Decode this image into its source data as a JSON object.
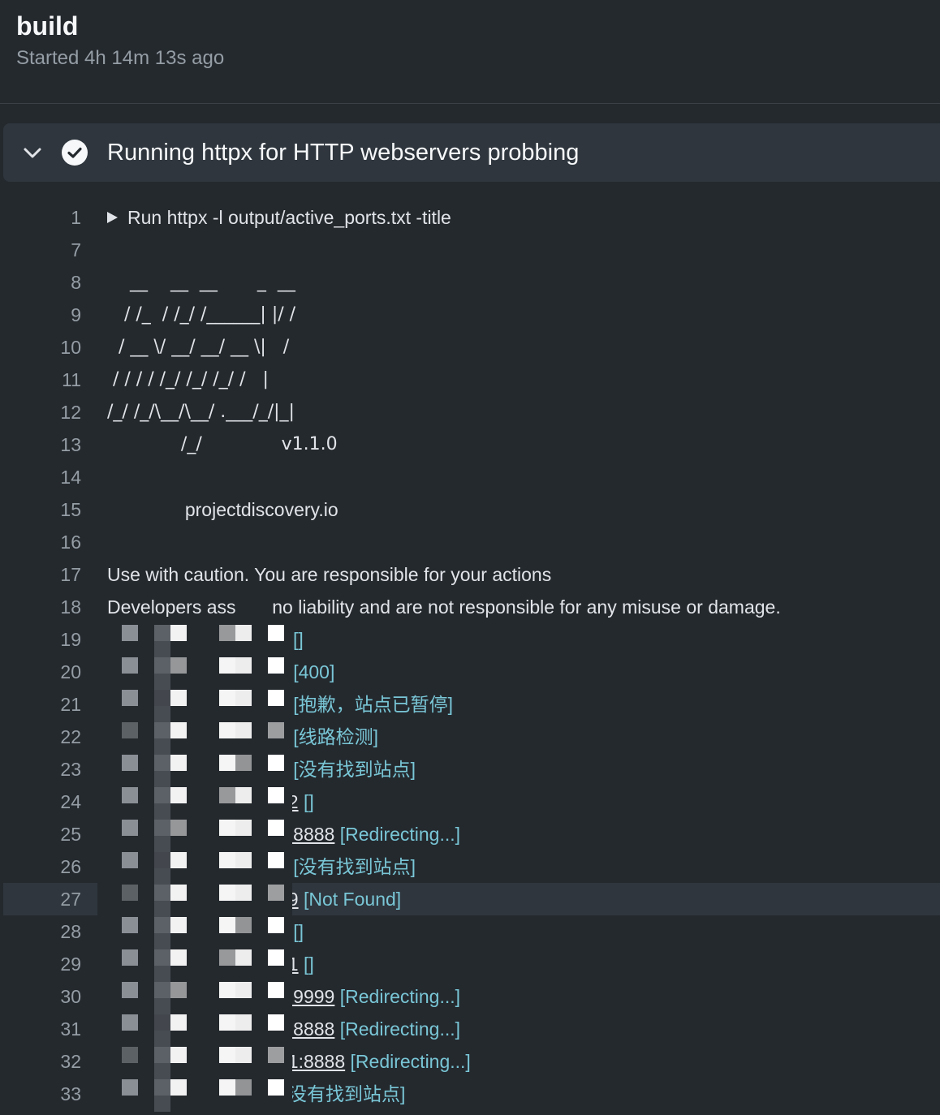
{
  "job": {
    "title": "build",
    "started": "Started 4h 14m 13s ago"
  },
  "step": {
    "title": "Running httpx for HTTP webservers probbing",
    "expand_icon": "chevron-down-icon",
    "status_icon": "check-circle-icon"
  },
  "colors": {
    "background": "#24292e",
    "step_header": "#2f363d",
    "tag_text": "#79c6d6",
    "line_number": "#959da5"
  },
  "log_lines": [
    {
      "num": "1",
      "kind": "cmd",
      "text": "Run httpx -l output/active_ports.txt -title"
    },
    {
      "num": "7",
      "kind": "blank",
      "text": ""
    },
    {
      "num": "8",
      "kind": "ascii",
      "text": "    __    __  __       _  __"
    },
    {
      "num": "9",
      "kind": "ascii",
      "text": "   / /_  / /_/ /______| |/ /"
    },
    {
      "num": "10",
      "kind": "ascii",
      "text": "  / __ \\/ __/ __/ __ \\|   /"
    },
    {
      "num": "11",
      "kind": "ascii",
      "text": " / / / / /_/ /_/ /_/ /   |"
    },
    {
      "num": "12",
      "kind": "ascii",
      "text": "/_/ /_/\\__/\\__/ .___/_/|_|"
    },
    {
      "num": "13",
      "kind": "ascii",
      "text": "             /_/              v1.1.0"
    },
    {
      "num": "14",
      "kind": "blank",
      "text": ""
    },
    {
      "num": "15",
      "kind": "plain",
      "text": "               projectdiscovery.io"
    },
    {
      "num": "16",
      "kind": "blank",
      "text": ""
    },
    {
      "num": "17",
      "kind": "plain",
      "text": "Use with caution. You are responsible for your actions"
    },
    {
      "num": "18",
      "kind": "plain",
      "text": "Developers ass       no liability and are not responsible for any misuse or damage."
    },
    {
      "num": "19",
      "kind": "result",
      "url_start": "h",
      "url_end": "3",
      "tag": "[]"
    },
    {
      "num": "20",
      "kind": "result",
      "url_start": "",
      "url_end": "2",
      "tag": "[400]"
    },
    {
      "num": "21",
      "kind": "result",
      "url_start": "",
      "url_end": "5",
      "tag": "[抱歉，站点已暂停]"
    },
    {
      "num": "22",
      "kind": "result",
      "url_start": "",
      "url_end": "2",
      "tag": "[线路检测]"
    },
    {
      "num": "23",
      "kind": "result",
      "url_start": "",
      "url_end": "1",
      "tag": "[没有找到站点]"
    },
    {
      "num": "24",
      "kind": "result",
      "url_start": "",
      "url_end": "12",
      "tag": "[]"
    },
    {
      "num": "25",
      "kind": "result",
      "url_start": "",
      "url_end": "2:8888",
      "tag": "[Redirecting...]"
    },
    {
      "num": "26",
      "kind": "result",
      "url_start": "",
      "url_end": "3",
      "tag": "[没有找到站点]"
    },
    {
      "num": "27",
      "kind": "result",
      "url_start": "",
      "url_end": "29",
      "tag": "[Not Found]",
      "highlight": true
    },
    {
      "num": "28",
      "kind": "result",
      "url_start": "",
      "url_end": "2",
      "tag": "[]"
    },
    {
      "num": "29",
      "kind": "result",
      "url_start": "",
      "url_end": "31",
      "tag": "[]"
    },
    {
      "num": "30",
      "kind": "result",
      "url_start": "",
      "url_end": "2:9999",
      "tag": "[Redirecting...]"
    },
    {
      "num": "31",
      "kind": "result",
      "url_start": "",
      "url_end": "5:8888",
      "tag": "[Redirecting...]"
    },
    {
      "num": "32",
      "kind": "result",
      "url_start": "",
      "url_end": "31:8888",
      "tag": "[Redirecting...]"
    },
    {
      "num": "33",
      "kind": "result",
      "url_start": "ht",
      "url_end": "",
      "tag": "[没有找到站点]"
    }
  ]
}
